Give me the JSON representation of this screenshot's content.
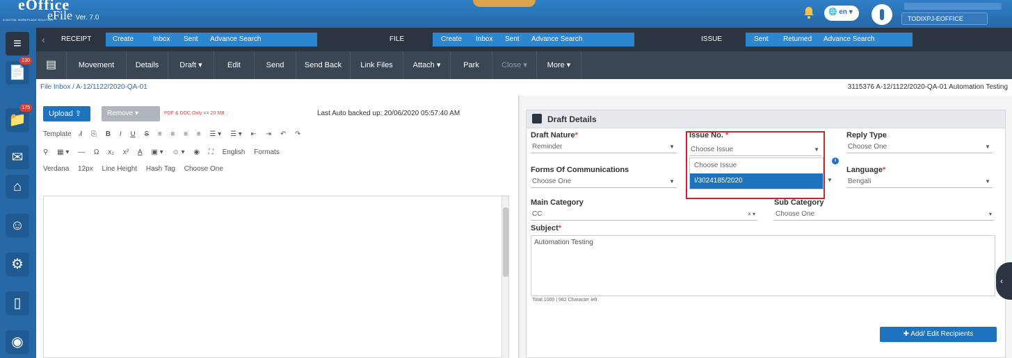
{
  "header": {
    "logo_text": "eOffice",
    "logo_tagline": "A DIGITAL WORKPLACE SOLUTION",
    "app_title": "eFile",
    "app_version": "Ver. 7.0",
    "language_label": "en",
    "user_badge": "TODIXPJ-EOFFICE"
  },
  "sidebar": {
    "items": [
      {
        "icon": "receipt-icon",
        "badge": "230"
      },
      {
        "icon": "file-icon",
        "badge": "175"
      },
      {
        "icon": "mail-icon",
        "badge": ""
      },
      {
        "icon": "home-icon",
        "badge": ""
      },
      {
        "icon": "user-icon",
        "badge": ""
      },
      {
        "icon": "settings-icon",
        "badge": ""
      },
      {
        "icon": "device-icon",
        "badge": ""
      },
      {
        "icon": "globe-icon",
        "badge": ""
      }
    ]
  },
  "nav": {
    "receipt_label": "RECEIPT",
    "receipt_links": [
      "Create",
      "Inbox",
      "Sent",
      "Advance Search"
    ],
    "file_label": "FILE",
    "file_links": [
      "Create",
      "Inbox",
      "Sent",
      "Advance Search"
    ],
    "issue_label": "ISSUE",
    "issue_links": [
      "Sent",
      "Returned",
      "Advance Search"
    ]
  },
  "toolbar": {
    "items": [
      "Movement",
      "Details",
      "Draft ▾",
      "Edit",
      "Send",
      "Send Back",
      "Link Files",
      "Attach ▾",
      "Park",
      "Close ▾",
      "More ▾"
    ]
  },
  "breadcrumb": {
    "path": "File Inbox / A-12/1122/2020-QA-01",
    "file_info": "3115376   A-12/1122/2020-QA-01   Automation Testing"
  },
  "editor": {
    "upload_label": "Upload",
    "remove_label": "Remove",
    "pdf_note": "PDF & DOC Only <= 20 MB",
    "autosave": "Last Auto backed up: 20/06/2020 05:57:40 AM",
    "row1": [
      "Template",
      "B",
      "I",
      "U",
      "S"
    ],
    "row2": [
      "Ω",
      "x₂",
      "x²",
      "A",
      "English",
      "Formats"
    ],
    "row3": [
      "Verdana",
      "12px",
      "Line Height",
      "Hash Tag",
      "Choose One"
    ]
  },
  "draft": {
    "title": "Draft Details",
    "draft_nature_label": "Draft Nature",
    "draft_nature_value": "Reminder",
    "issue_no_label": "Issue No.",
    "issue_no_value": "Choose Issue",
    "reply_type_label": "Reply Type",
    "reply_type_value": "Choose One",
    "forms_label": "Forms Of Communications",
    "forms_value": "Choose One",
    "language_label": "Language",
    "language_value": "Bengali",
    "main_cat_label": "Main Category",
    "main_cat_value": "CC",
    "sub_cat_label": "Sub Category",
    "sub_cat_value": "Choose One",
    "subject_label": "Subject",
    "subject_value": "Automation Testing",
    "char_count": "Total 1000 | 982 Character left",
    "recipients_button": "Add/ Edit Recipients",
    "dropdown_options": [
      "Choose Issue",
      "I/3024185/2020"
    ]
  }
}
